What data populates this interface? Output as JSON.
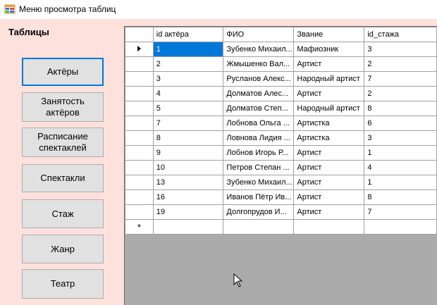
{
  "window": {
    "title": "Меню просмотра таблиц",
    "icon": "table-app-icon"
  },
  "sidebar": {
    "title": "Таблицы",
    "buttons": [
      {
        "label": "Актёры",
        "active": true
      },
      {
        "label": "Занятость\nактёров",
        "active": false
      },
      {
        "label": "Расписание\nспектаклей",
        "active": false
      },
      {
        "label": "Спектакли",
        "active": false
      },
      {
        "label": "Стаж",
        "active": false
      },
      {
        "label": "Жанр",
        "active": false
      },
      {
        "label": "Театр",
        "active": false
      }
    ]
  },
  "grid": {
    "columns": [
      "id актёра",
      "ФИО",
      "Звание",
      "id_стажа"
    ],
    "rows": [
      [
        "1",
        "Зубенко Михаил...",
        "Мафиозник",
        "3"
      ],
      [
        "2",
        "Жмышенко Вал...",
        "Артист",
        "2"
      ],
      [
        "3",
        "Русланов Алекс...",
        "Народный артист",
        "7"
      ],
      [
        "4",
        "Долматов Алес...",
        "Артист",
        "2"
      ],
      [
        "5",
        "Долматов Степ...",
        "Народный артист",
        "8"
      ],
      [
        "7",
        "Лобнова Ольга ...",
        "Артистка",
        "6"
      ],
      [
        "8",
        "Ловнова Лидия ...",
        "Артистка",
        "3"
      ],
      [
        "9",
        "Лобнов Игорь Р...",
        "Артист",
        "1"
      ],
      [
        "10",
        "Петров Степан ...",
        "Артист",
        "4"
      ],
      [
        "13",
        "Зубенко Михаил...",
        "Артист",
        "1"
      ],
      [
        "16",
        "Иванов Пётр Ив...",
        "Артист",
        "8"
      ],
      [
        "19",
        "Долгопрудов И...",
        "Артист",
        "7"
      ]
    ],
    "current_row_index": 0,
    "new_row_marker": "*",
    "selection_color": "#0078d7"
  }
}
